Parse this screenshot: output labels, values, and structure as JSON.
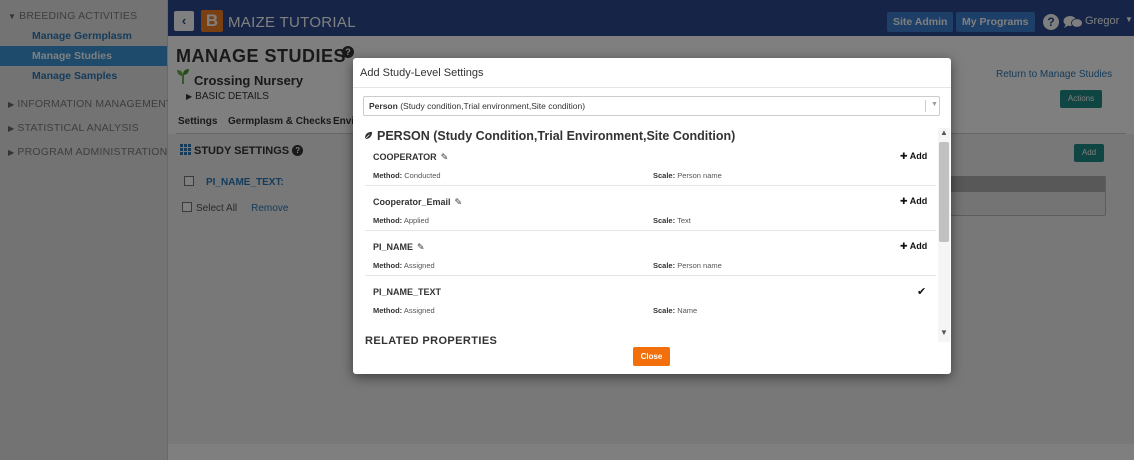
{
  "sidebar": {
    "sections": [
      {
        "label": "BREEDING ACTIVITIES",
        "arrow": "▼"
      },
      {
        "label": "INFORMATION MANAGEMENT",
        "arrow": "▶"
      },
      {
        "label": "STATISTICAL ANALYSIS",
        "arrow": "▶"
      },
      {
        "label": "PROGRAM ADMINISTRATION",
        "arrow": "▶"
      }
    ],
    "items": [
      {
        "label": "Manage Germplasm"
      },
      {
        "label": "Manage Studies",
        "active": true
      },
      {
        "label": "Manage Samples"
      }
    ]
  },
  "topbar": {
    "back_icon": "‹",
    "logo_letter": "B",
    "app_title": "MAIZE TUTORIAL",
    "site_admin": "Site Admin",
    "my_programs": "My Programs",
    "help_glyph": "?",
    "user_name": "Gregor",
    "user_caret": "▼"
  },
  "page": {
    "title": "MANAGE STUDIES",
    "study_name": "Crossing Nursery",
    "basic_details": "BASIC DETAILS",
    "return_link": "Return to Manage Studies",
    "actions_label": "Actions",
    "tabs": [
      "Settings",
      "Germplasm & Checks",
      "Envi"
    ],
    "study_settings_title": "STUDY SETTINGS",
    "variable_row": "PI_NAME_TEXT:",
    "select_all": "Select All",
    "remove": "Remove",
    "add_label": "Add"
  },
  "modal": {
    "title": "Add Study-Level Settings",
    "dropdown": {
      "selected_bold": "Person",
      "selected_rest": " (Study condition,Trial environment,Site condition)"
    },
    "property_heading": "PERSON (Study Condition,Trial Environment,Site Condition)",
    "variables": [
      {
        "name": "COOPERATOR",
        "method_label": "Method:",
        "method": "Conducted",
        "scale_label": "Scale:",
        "scale": "Person name",
        "action": "Add",
        "added": false
      },
      {
        "name": "Cooperator_Email",
        "method_label": "Method:",
        "method": "Applied",
        "scale_label": "Scale:",
        "scale": "Text",
        "action": "Add",
        "added": false
      },
      {
        "name": "PI_NAME",
        "method_label": "Method:",
        "method": "Assigned",
        "scale_label": "Scale:",
        "scale": "Person name",
        "action": "Add",
        "added": false
      },
      {
        "name": "PI_NAME_TEXT",
        "method_label": "Method:",
        "method": "Assigned",
        "scale_label": "Scale:",
        "scale": "Name",
        "action": "",
        "added": true
      }
    ],
    "related_heading": "RELATED PROPERTIES",
    "close_label": "Close"
  },
  "icons": {
    "pencil": "pencil-icon",
    "plus": "plus-icon",
    "check": "check-icon",
    "leaf": "leaf-icon"
  },
  "colors": {
    "topbar": "#2c4a8e",
    "link": "#2a78b6",
    "active_nav": "#3c97d6",
    "teal_button": "#1f8a84",
    "close_button": "#f26f0b"
  }
}
